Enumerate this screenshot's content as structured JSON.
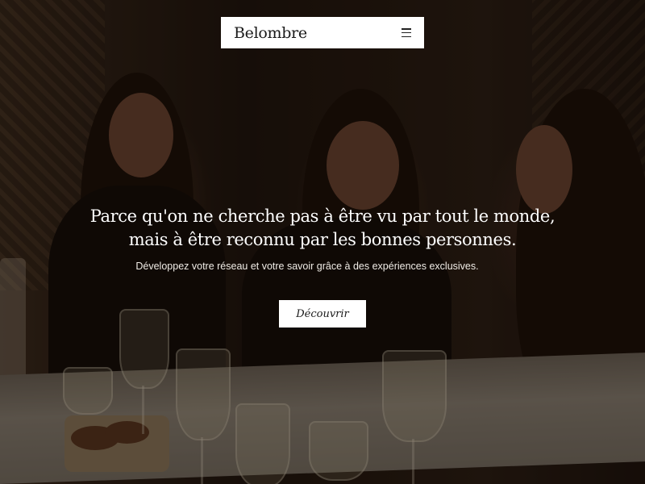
{
  "header": {
    "brand": "Belombre",
    "menu_icon": "hamburger-menu-icon"
  },
  "hero": {
    "headline_line1": "Parce qu'on ne cherche pas à être vu par tout le monde,",
    "headline_line2": "mais à être reconnu par les bonnes personnes.",
    "subtitle": "Développez votre réseau et votre savoir grâce à des expériences exclusives.",
    "cta_label": "Découvrir"
  },
  "colors": {
    "header_bg": "#ffffff",
    "text_on_hero": "#ffffff",
    "button_bg": "#ffffff"
  }
}
